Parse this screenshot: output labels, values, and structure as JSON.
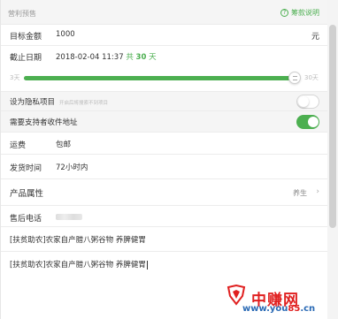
{
  "header": {
    "title": "营利预售",
    "help_label": "筹款说明"
  },
  "target": {
    "label": "目标金额",
    "value": "1000",
    "unit": "元"
  },
  "deadline": {
    "label": "截止日期",
    "date": "2018-02-04 11:37",
    "prefix": "共",
    "days": "30",
    "suffix": "天"
  },
  "slider": {
    "min_label": "3天",
    "max_label": "30天",
    "fill_fraction": 1.0
  },
  "privacy": {
    "label": "设为隐私项目",
    "hint": "开启后将搜索不到项目",
    "on": false
  },
  "address": {
    "label": "需要支持者收件地址",
    "on": true
  },
  "shipping": {
    "label": "运费",
    "value": "包邮"
  },
  "ship_time": {
    "label": "发货时间",
    "value": "72小时内"
  },
  "attrs": {
    "label": "产品属性",
    "value": "养生"
  },
  "phone": {
    "label": "售后电话"
  },
  "line1": {
    "text": "[扶贫助农]农家自产腊八粥谷物 养脾健胃"
  },
  "line2": {
    "text": "[扶贫助农]农家自产腊八粥谷物 养脾健胃"
  },
  "watermark": {
    "brand": "中赚网",
    "url_prefix": "www.you",
    "url_num": "85",
    "url_suffix": ".cn"
  },
  "colors": {
    "accent": "#4caf50",
    "watermark_red": "#e02020"
  }
}
